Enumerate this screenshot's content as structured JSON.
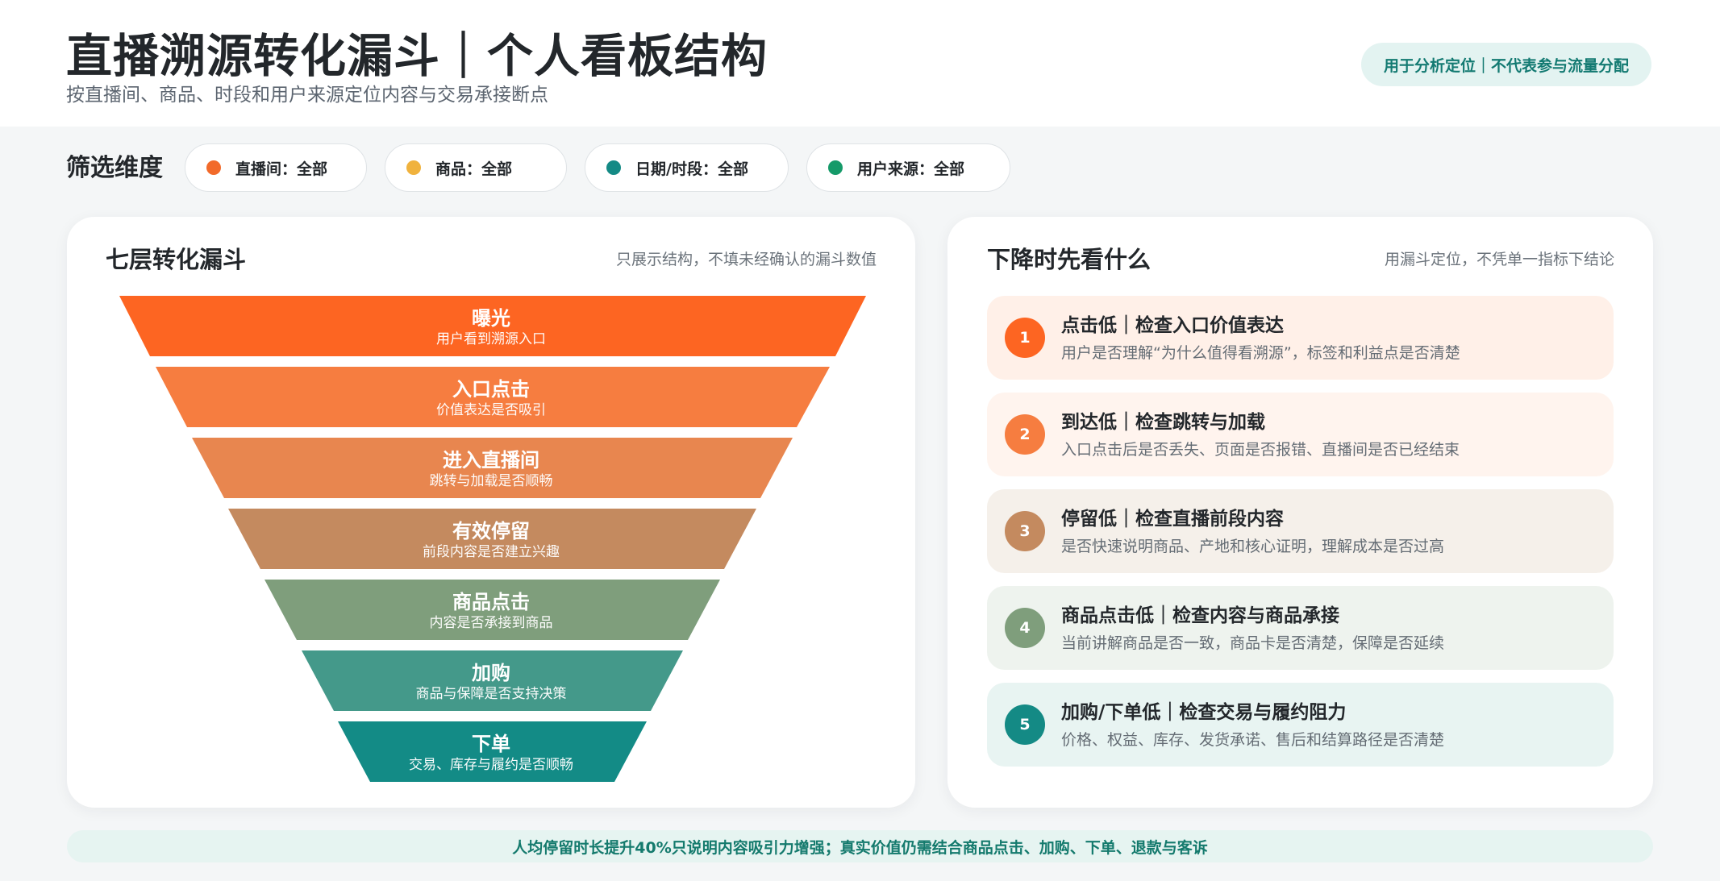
{
  "header": {
    "title": "直播溯源转化漏斗｜个人看板结构",
    "subtitle": "按直播间、商品、时段和用户来源定位内容与交易承接断点",
    "badge": "用于分析定位｜不代表参与流量分配"
  },
  "filters": {
    "title": "筛选维度",
    "chips": [
      {
        "label": "直播间：全部",
        "color": "#f26a2a"
      },
      {
        "label": "商品：全部",
        "color": "#f0b23d"
      },
      {
        "label": "日期/时段：全部",
        "color": "#148a85"
      },
      {
        "label": "用户来源：全部",
        "color": "#159a69"
      }
    ]
  },
  "funnel_card": {
    "title": "七层转化漏斗",
    "note": "只展示结构，不填未经确认的漏斗数值",
    "tiers": [
      {
        "name": "曝光",
        "desc": "用户看到溯源入口",
        "color": "#fd6522"
      },
      {
        "name": "入口点击",
        "desc": "价值表达是否吸引",
        "color": "#f67d40"
      },
      {
        "name": "进入直播间",
        "desc": "跳转与加载是否顺畅",
        "color": "#e8864f"
      },
      {
        "name": "有效停留",
        "desc": "前段内容是否建立兴趣",
        "color": "#c48a5f"
      },
      {
        "name": "商品点击",
        "desc": "内容是否承接到商品",
        "color": "#7f9e7c"
      },
      {
        "name": "加购",
        "desc": "商品与保障是否支持决策",
        "color": "#44998a"
      },
      {
        "name": "下单",
        "desc": "交易、库存与履约是否顺畅",
        "color": "#138b86"
      }
    ]
  },
  "checks_card": {
    "title": "下降时先看什么",
    "note": "用漏斗定位，不凭单一指标下结论",
    "items": [
      {
        "num": "1",
        "title": "点击低｜检查入口价值表达",
        "desc": "用户是否理解“为什么值得看溯源”，标签和利益点是否清楚",
        "color": "#fd6522",
        "bg": "#fff0e8"
      },
      {
        "num": "2",
        "title": "到达低｜检查跳转与加载",
        "desc": "入口点击后是否丢失、页面是否报错、直播间是否已经结束",
        "color": "#f67d40",
        "bg": "#fff4ee"
      },
      {
        "num": "3",
        "title": "停留低｜检查直播前段内容",
        "desc": "是否快速说明商品、产地和核心证明，理解成本是否过高",
        "color": "#c48a5f",
        "bg": "#f5f0ea"
      },
      {
        "num": "4",
        "title": "商品点击低｜检查内容与商品承接",
        "desc": "当前讲解商品是否一致，商品卡是否清楚，保障是否延续",
        "color": "#7f9e7c",
        "bg": "#eef3ee"
      },
      {
        "num": "5",
        "title": "加购/下单低｜检查交易与履约阻力",
        "desc": "价格、权益、库存、发货承诺、售后和结算路径是否清楚",
        "color": "#148a85",
        "bg": "#e8f4f2"
      }
    ]
  },
  "footer": {
    "text": "人均停留时长提升40%只说明内容吸引力增强；真实价值仍需结合商品点击、加购、下单、退款与客诉"
  }
}
